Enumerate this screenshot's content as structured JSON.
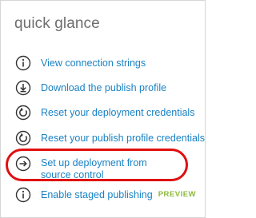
{
  "panel": {
    "title": "quick glance"
  },
  "links": [
    {
      "label": "View connection strings",
      "icon": "info-icon"
    },
    {
      "label": "Download the publish profile",
      "icon": "download-icon"
    },
    {
      "label": "Reset your deployment credentials",
      "icon": "reset-icon"
    },
    {
      "label": "Reset your publish profile credentials",
      "icon": "reset-icon"
    },
    {
      "label": "Set up deployment from source control",
      "icon": "arrow-right-icon"
    },
    {
      "label": "Enable staged publishing",
      "icon": "info-icon",
      "badge": "PREVIEW"
    }
  ],
  "colors": {
    "link": "#1a82c4",
    "title": "#6e6e6e",
    "badge": "#8cb93c",
    "highlight": "#e01010"
  }
}
